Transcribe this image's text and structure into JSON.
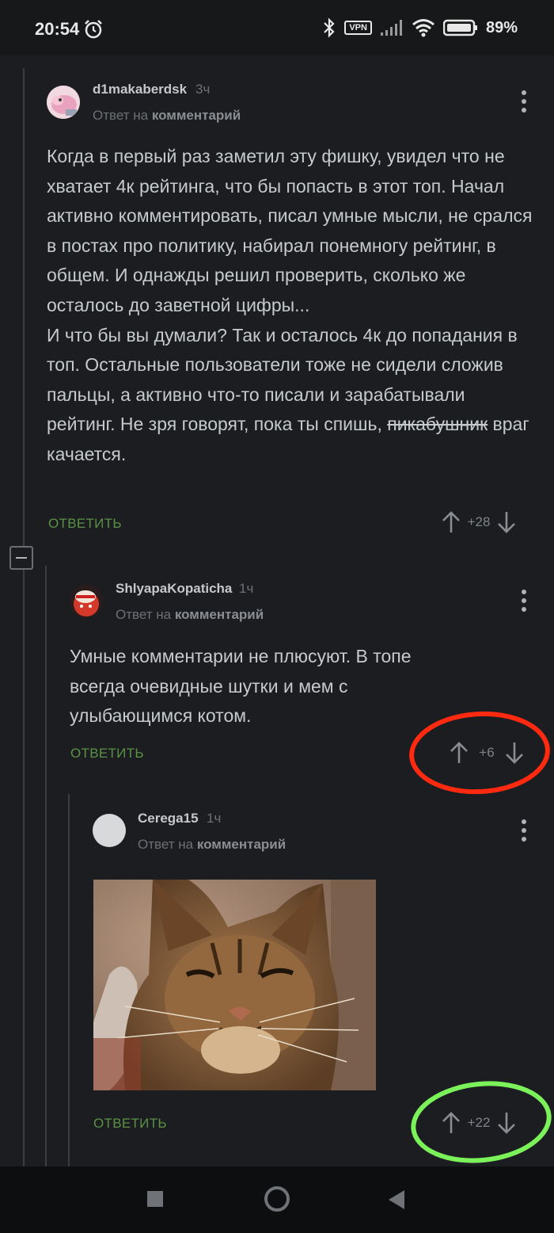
{
  "status_bar": {
    "time": "20:54",
    "vpn": "VPN",
    "battery": "89%"
  },
  "comments": [
    {
      "username": "d1makaberdsk",
      "time": "3ч",
      "reply_prefix": "Ответ на",
      "reply_target": "комментарий",
      "text_before_strike": "Когда в первый раз заметил эту фишку, увидел что не хватает 4к рейтинга, что бы попасть в этот топ. Начал активно комментировать, писал умные мысли, не срался в постах про политику, набирал понемногу рейтинг, в общем. И однажды решил проверить, сколько же осталось до заветной цифры...\nИ что бы вы думали? Так и осталось 4к до попадания в топ. Остальные пользователи тоже не сидели сложив пальцы, а активно что-то писали и зарабатывали рейтинг. Не зря говорят, пока ты спишь, ",
      "strike_text": "пикабушник",
      "text_after_strike": "  враг качается.",
      "reply_label": "ОТВЕТИТЬ",
      "score": "+28"
    },
    {
      "username": "ShlyapaKopaticha",
      "time": "1ч",
      "reply_prefix": "Ответ на",
      "reply_target": "комментарий",
      "text": "Умные комментарии не плюсуют. В топе всегда очевидные шутки и мем с улыбающимся котом.",
      "reply_label": "ОТВЕТИТЬ",
      "score": "+6"
    },
    {
      "username": "Cerega15",
      "time": "1ч",
      "reply_prefix": "Ответ на",
      "reply_target": "комментарий",
      "reply_label": "ОТВЕТИТЬ",
      "score": "+22"
    }
  ],
  "colors": {
    "background": "#1b1d20",
    "reply_green": "#5a9244",
    "annotation_red": "#ff2a10",
    "annotation_green": "#7cf25a"
  }
}
